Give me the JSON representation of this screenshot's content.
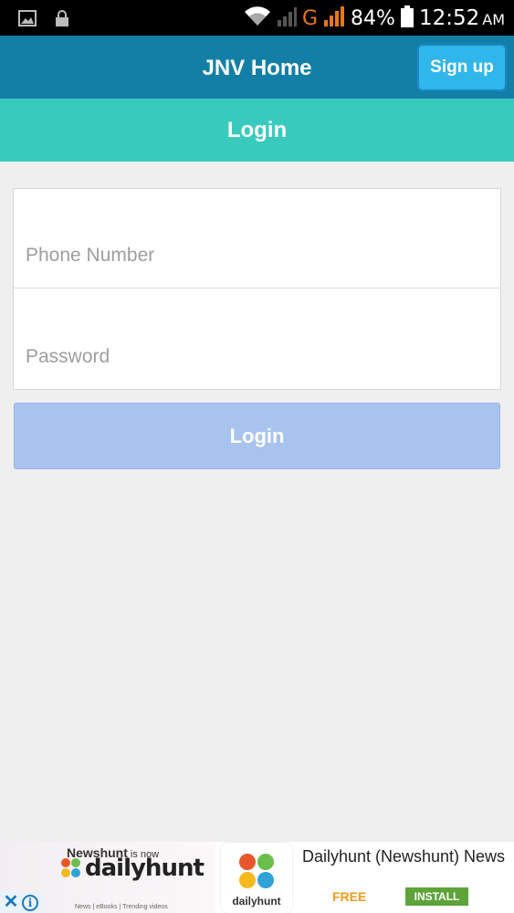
{
  "status_bar": {
    "battery": "84%",
    "time": "12:52",
    "ampm": "AM",
    "network": "G",
    "icons": [
      "image-icon",
      "lock-icon",
      "wifi-icon",
      "signal-icon",
      "signal-icon",
      "battery-icon"
    ]
  },
  "header": {
    "title": "JNV Home",
    "signup_label": "Sign up"
  },
  "subheader": {
    "title": "Login"
  },
  "form": {
    "phone_placeholder": "Phone Number",
    "password_placeholder": "Password",
    "login_label": "Login"
  },
  "ad": {
    "brand_old": "Newshunt",
    "brand_isnow": "is now",
    "brand_new": "dailyhunt",
    "tagline": "News | eBooks | Trending videos",
    "icon_label": "dailyhunt",
    "title": "Dailyhunt (Newshunt) News",
    "price": "FREE",
    "install_label": "INSTALL"
  },
  "colors": {
    "header": "#147fa6",
    "signup_button": "#2fb6ea",
    "subheader": "#38cbbd",
    "login_button_disabled": "#a9c3ef",
    "background": "#efefef"
  }
}
